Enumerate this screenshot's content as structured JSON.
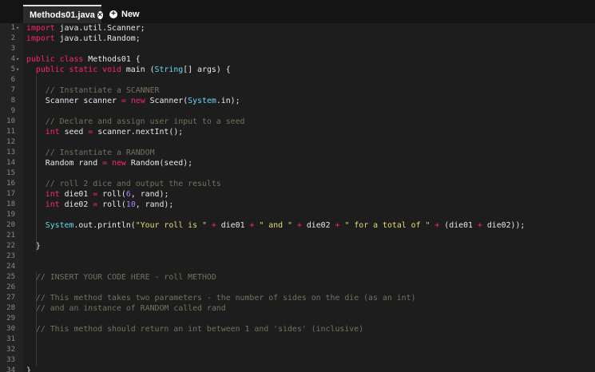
{
  "tabs": [
    {
      "label": "Methods01.java",
      "active": true
    },
    {
      "label": "New",
      "active": false
    }
  ],
  "colors": {
    "background": "#1d1d1d",
    "keyword": "#f92672",
    "type": "#66d9ef",
    "comment": "#75715e",
    "string": "#e6db74",
    "number": "#ae81ff"
  },
  "lines": [
    {
      "num": "1",
      "fold": true,
      "tokens": [
        {
          "k": "k",
          "t": "import"
        },
        {
          "t": " java.util.Scanner;"
        }
      ]
    },
    {
      "num": "2",
      "tokens": [
        {
          "k": "k",
          "t": "import"
        },
        {
          "t": " java.util.Random;"
        }
      ]
    },
    {
      "num": "3",
      "tokens": []
    },
    {
      "num": "4",
      "fold": true,
      "tokens": [
        {
          "k": "k",
          "t": "public"
        },
        {
          "t": " "
        },
        {
          "k": "k",
          "t": "class"
        },
        {
          "t": " Methods01 {"
        }
      ]
    },
    {
      "num": "5",
      "fold": true,
      "tokens": [
        {
          "t": "  "
        },
        {
          "k": "k",
          "t": "public"
        },
        {
          "t": " "
        },
        {
          "k": "k",
          "t": "static"
        },
        {
          "t": " "
        },
        {
          "k": "k",
          "t": "void"
        },
        {
          "t": " main ("
        },
        {
          "k": "t",
          "t": "String"
        },
        {
          "t": "[] args) {"
        }
      ]
    },
    {
      "num": "6",
      "tokens": []
    },
    {
      "num": "7",
      "tokens": [
        {
          "t": "    "
        },
        {
          "k": "c",
          "t": "// Instantiate a SCANNER"
        }
      ]
    },
    {
      "num": "8",
      "tokens": [
        {
          "t": "    Scanner scanner "
        },
        {
          "k": "o",
          "t": "="
        },
        {
          "t": " "
        },
        {
          "k": "k",
          "t": "new"
        },
        {
          "t": " Scanner("
        },
        {
          "k": "t",
          "t": "System"
        },
        {
          "t": ".in);"
        }
      ]
    },
    {
      "num": "9",
      "tokens": []
    },
    {
      "num": "10",
      "tokens": [
        {
          "t": "    "
        },
        {
          "k": "c",
          "t": "// Declare and assign user input to a seed"
        }
      ]
    },
    {
      "num": "11",
      "tokens": [
        {
          "t": "    "
        },
        {
          "k": "k",
          "t": "int"
        },
        {
          "t": " seed "
        },
        {
          "k": "o",
          "t": "="
        },
        {
          "t": " scanner.nextInt();"
        }
      ]
    },
    {
      "num": "12",
      "tokens": []
    },
    {
      "num": "13",
      "tokens": [
        {
          "t": "    "
        },
        {
          "k": "c",
          "t": "// Instantiate a RANDOM"
        }
      ]
    },
    {
      "num": "14",
      "tokens": [
        {
          "t": "    Random rand "
        },
        {
          "k": "o",
          "t": "="
        },
        {
          "t": " "
        },
        {
          "k": "k",
          "t": "new"
        },
        {
          "t": " Random(seed);"
        }
      ]
    },
    {
      "num": "15",
      "tokens": []
    },
    {
      "num": "16",
      "tokens": [
        {
          "t": "    "
        },
        {
          "k": "c",
          "t": "// roll 2 dice and output the results"
        }
      ]
    },
    {
      "num": "17",
      "tokens": [
        {
          "t": "    "
        },
        {
          "k": "k",
          "t": "int"
        },
        {
          "t": " die01 "
        },
        {
          "k": "o",
          "t": "="
        },
        {
          "t": " roll("
        },
        {
          "k": "n",
          "t": "6"
        },
        {
          "t": ", rand);"
        }
      ]
    },
    {
      "num": "18",
      "tokens": [
        {
          "t": "    "
        },
        {
          "k": "k",
          "t": "int"
        },
        {
          "t": " die02 "
        },
        {
          "k": "o",
          "t": "="
        },
        {
          "t": " roll("
        },
        {
          "k": "n",
          "t": "10"
        },
        {
          "t": ", rand);"
        }
      ]
    },
    {
      "num": "19",
      "tokens": []
    },
    {
      "num": "20",
      "tokens": [
        {
          "t": "    "
        },
        {
          "k": "t",
          "t": "System"
        },
        {
          "t": ".out.println("
        },
        {
          "k": "s",
          "t": "\"Your roll is \""
        },
        {
          "t": " "
        },
        {
          "k": "o",
          "t": "+"
        },
        {
          "t": " die01 "
        },
        {
          "k": "o",
          "t": "+"
        },
        {
          "t": " "
        },
        {
          "k": "s",
          "t": "\" and \""
        },
        {
          "t": " "
        },
        {
          "k": "o",
          "t": "+"
        },
        {
          "t": " die02 "
        },
        {
          "k": "o",
          "t": "+"
        },
        {
          "t": " "
        },
        {
          "k": "s",
          "t": "\" for a total of \""
        },
        {
          "t": " "
        },
        {
          "k": "o",
          "t": "+"
        },
        {
          "t": " (die01 "
        },
        {
          "k": "o",
          "t": "+"
        },
        {
          "t": " die02));"
        }
      ]
    },
    {
      "num": "21",
      "tokens": []
    },
    {
      "num": "22",
      "tokens": [
        {
          "t": "  }"
        }
      ]
    },
    {
      "num": "23",
      "tokens": []
    },
    {
      "num": "24",
      "tokens": []
    },
    {
      "num": "25",
      "tokens": [
        {
          "t": "  "
        },
        {
          "k": "c",
          "t": "// INSERT YOUR CODE HERE - roll METHOD"
        }
      ]
    },
    {
      "num": "26",
      "tokens": []
    },
    {
      "num": "27",
      "tokens": [
        {
          "t": "  "
        },
        {
          "k": "c",
          "t": "// This method takes two parameters - the number of sides on the die (as an int)"
        }
      ]
    },
    {
      "num": "28",
      "tokens": [
        {
          "t": "  "
        },
        {
          "k": "c",
          "t": "// and an instance of RANDOM called rand"
        }
      ]
    },
    {
      "num": "29",
      "tokens": []
    },
    {
      "num": "30",
      "tokens": [
        {
          "t": "  "
        },
        {
          "k": "c",
          "t": "// This method should return an int between 1 and 'sides' (inclusive)"
        }
      ]
    },
    {
      "num": "31",
      "tokens": []
    },
    {
      "num": "32",
      "tokens": []
    },
    {
      "num": "33",
      "tokens": []
    },
    {
      "num": "34",
      "tokens": [
        {
          "t": "}"
        }
      ]
    }
  ]
}
